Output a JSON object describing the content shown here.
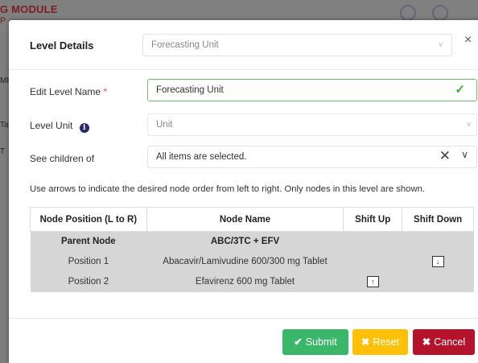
{
  "background": {
    "module_title": "G MODULE",
    "sub_text": "P -",
    "side_texts": [
      "MH",
      "Ta",
      "T"
    ]
  },
  "modal": {
    "title": "Level Details",
    "level_select": "Forecasting Unit",
    "close_label": "×",
    "edit_level_name_label": "Edit Level Name",
    "required_mark": "*",
    "level_name_value": "Forecasting Unit",
    "level_unit_label": "Level Unit",
    "level_unit_placeholder": "Unit",
    "see_children_label": "See children of",
    "see_children_value": "All items are selected.",
    "instruction": "Use arrows to indicate the desired node order from left to right. Only nodes in this level are shown."
  },
  "table": {
    "headers": [
      "Node Position (L to R)",
      "Node Name",
      "Shift Up",
      "Shift Down"
    ],
    "rows": [
      {
        "position": "Parent Node",
        "name": "ABC/3TC + EFV",
        "shift_up": "",
        "shift_down": ""
      },
      {
        "position": "Position 1",
        "name": "Abacavir/Lamivudine 600/300 mg Tablet",
        "shift_up": "",
        "shift_down": "↓"
      },
      {
        "position": "Position 2",
        "name": "Efavirenz 600 mg Tablet",
        "shift_up": "↑",
        "shift_down": ""
      }
    ]
  },
  "buttons": {
    "submit": "Submit",
    "reset": "Reset",
    "cancel": "Cancel"
  },
  "colors": {
    "submit": "#3bb76a",
    "reset": "#ffc107",
    "cancel": "#b5122b",
    "valid": "#3ca83c"
  }
}
